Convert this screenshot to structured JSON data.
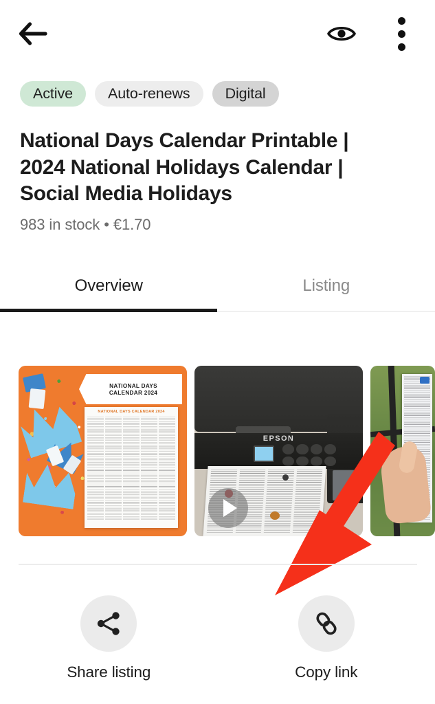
{
  "app": {
    "screen_name": "Listing detail — Overview"
  },
  "topbar": {
    "back_icon": "back-arrow-icon",
    "preview_icon": "eye-icon",
    "overflow_icon": "three-dot-menu-icon"
  },
  "badges": [
    {
      "label": "Active",
      "bg": "#cfe8d5",
      "fg": "#1f1f1f"
    },
    {
      "label": "Auto-renews",
      "bg": "#ededed",
      "fg": "#1f1f1f"
    },
    {
      "label": "Digital",
      "bg": "#d4d4d4",
      "fg": "#1f1f1f"
    }
  ],
  "listing": {
    "title": "National Days Calendar Printable | 2024 National Holidays Calendar | Social Media Holidays",
    "stock_and_price": "983 in stock • €1.70",
    "stock_count": "983",
    "price": "€1.70",
    "currency_symbol": "€"
  },
  "tabs": {
    "items": [
      {
        "label": "Overview",
        "active": true
      },
      {
        "label": "Listing",
        "active": false
      }
    ],
    "active_index": 0,
    "underline_color": "#1a1a1a"
  },
  "media": {
    "thumbnails": [
      {
        "name": "calendar-product-photo",
        "type": "image",
        "banner_line_1": "NATIONAL DAYS",
        "banner_line_2": "CALENDAR 2024",
        "sheet_title": "NATIONAL DAYS CALENDAR 2024",
        "background_color": "#ef7b2e"
      },
      {
        "name": "printer-demo-video",
        "type": "video",
        "brand_text": "EPSON",
        "has_play_button": true
      },
      {
        "name": "hand-holding-calendar-photo",
        "type": "image",
        "partially_visible": true
      }
    ]
  },
  "annotation": {
    "type": "arrow",
    "color": "#f5301a",
    "points_to": "Copy link"
  },
  "actions": [
    {
      "label": "Share listing",
      "icon": "share-icon"
    },
    {
      "label": "Copy link",
      "icon": "link-icon"
    }
  ]
}
